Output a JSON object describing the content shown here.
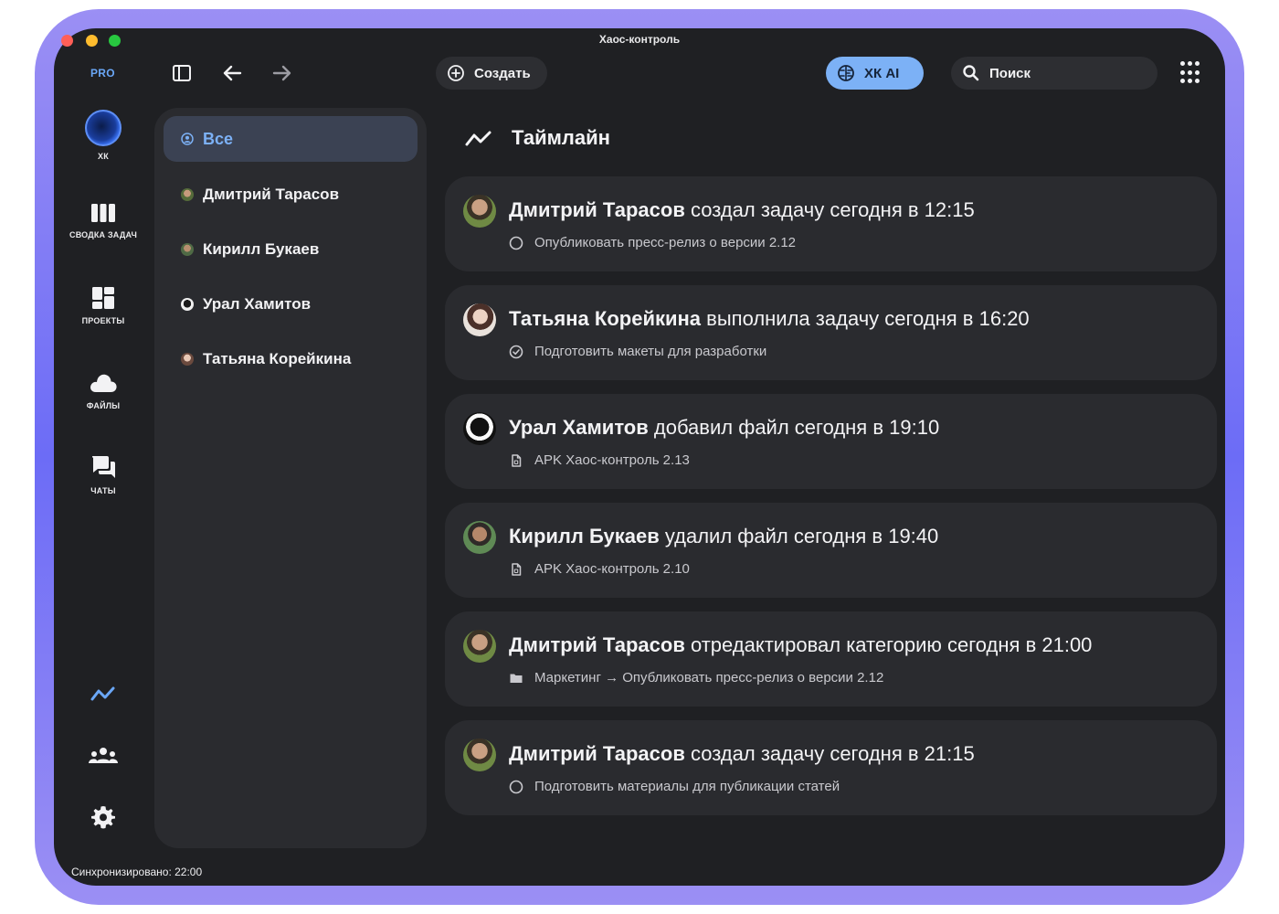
{
  "window": {
    "title": "Хаос-контроль",
    "sync_status": "Синхронизировано: 22:00"
  },
  "toolbar": {
    "plan_badge": "PRO",
    "create_label": "Создать",
    "ai_label": "ХК AI",
    "search_label": "Поиск"
  },
  "rail": {
    "workspace_label": "ХК",
    "items": [
      {
        "label": "СВОДКА ЗАДАЧ",
        "icon": "columns-icon"
      },
      {
        "label": "ПРОЕКТЫ",
        "icon": "dashboard-icon"
      },
      {
        "label": "ФАЙЛЫ",
        "icon": "cloud-icon"
      },
      {
        "label": "ЧАТЫ",
        "icon": "chat-icon"
      }
    ],
    "bottom_icons": [
      "timeline-icon",
      "team-icon",
      "settings-icon"
    ]
  },
  "people_panel": {
    "items": [
      {
        "label": "Все",
        "active": true
      },
      {
        "label": "Дмитрий Тарасов"
      },
      {
        "label": "Кирилл Букаев"
      },
      {
        "label": "Урал Хамитов"
      },
      {
        "label": "Татьяна Корейкина"
      }
    ]
  },
  "timeline": {
    "title": "Таймлайн",
    "events": [
      {
        "actor": "Дмитрий Тарасов",
        "action": "создал задачу сегодня в 12:15",
        "detail": "Опубликовать пресс-релиз о версии 2.12",
        "detail_icon": "circle-icon"
      },
      {
        "actor": "Татьяна Корейкина",
        "action": "выполнила задачу сегодня в 16:20",
        "detail": "Подготовить макеты для разработки",
        "detail_icon": "check-circle-icon"
      },
      {
        "actor": "Урал Хамитов",
        "action": "добавил файл сегодня в 19:10",
        "detail": "APK Хаос-контроль 2.13",
        "detail_icon": "file-icon"
      },
      {
        "actor": "Кирилл Букаев",
        "action": "удалил файл сегодня в 19:40",
        "detail": "APK Хаос-контроль 2.10",
        "detail_icon": "file-icon"
      },
      {
        "actor": "Дмитрий Тарасов",
        "action": "отредактировал категорию сегодня в 21:00",
        "detail": "Маркетинг → Опубликовать пресс-релиз о версии 2.12",
        "detail_icon": "folder-icon"
      },
      {
        "actor": "Дмитрий Тарасов",
        "action": "создал задачу сегодня в 21:15",
        "detail": "Подготовить материалы для публикации статей",
        "detail_icon": "circle-icon"
      }
    ]
  },
  "colors": {
    "accent": "#7cb1f6",
    "background": "#1f2023",
    "panel": "#2a2b2f",
    "frame": "#7b74f5"
  }
}
